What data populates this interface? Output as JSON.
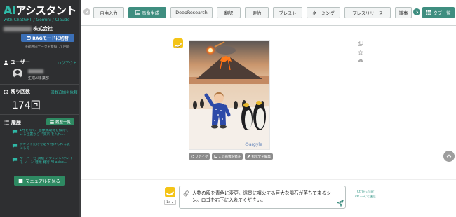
{
  "sidebar": {
    "logo_ai": "AI",
    "logo_rest": "アシスタント",
    "logo_sub": "with ChatGPT / Gemini / Claude",
    "company_suffix": "株式会社",
    "rag_button": "RAGモードに切替",
    "rag_note": "※範囲内データを参照して回答",
    "user_section": "ユーザー",
    "logout": "ログアウト",
    "user_dept": "生成AI事業部",
    "remaining_section": "残り回数",
    "add_request": "回数追加を依頼",
    "remaining_count": "174回",
    "history_section": "履歴",
    "history_button": "履歴一覧",
    "history": [
      {
        "lines": [
          "1月を育て、画像数期待を加えて",
          "いる位置から「東京 を入れ…"
        ]
      },
      {
        "lines": [
          "テキストだけで貼り付けられる表",
          "にして"
        ]
      },
      {
        "lines": [
          "サーバー名 試験 アテンスレ/ホスト",
          "モ ソーン 種類 発行 AI-asiso…"
        ]
      }
    ],
    "manual_button": "マニュアルを見る"
  },
  "tabs": {
    "items": [
      {
        "label": "自由入力",
        "active": false
      },
      {
        "label": "画像生成",
        "active": true
      },
      {
        "label": "DeepResearch",
        "active": false
      },
      {
        "label": "翻訳",
        "active": false
      },
      {
        "label": "要約",
        "active": false
      },
      {
        "label": "ブレスト",
        "active": false
      },
      {
        "label": "ネーミング",
        "active": false
      },
      {
        "label": "プレスリリース",
        "active": false
      },
      {
        "label": "議事",
        "active": false
      }
    ],
    "list_button": "タブ一覧"
  },
  "image": {
    "watermark": "argyle",
    "actions": [
      "リテイク",
      "この画像を修正",
      "指示文を編集"
    ]
  },
  "prompt": {
    "model": "1e",
    "text": "人物の服を青色に変更。遠景に噴火する巨大な隕石が落ちて来るシーン。ロゴを右下に入れてください。",
    "hint_line1": "Ctrl+Enter",
    "hint_line2": "(⌘+↩)で送信"
  },
  "colors": {
    "accent": "#3f8e80",
    "sidebar_bg": "#2e2f31",
    "teal_text": "#2fb8a6",
    "rag_blue": "#3b6fb6"
  }
}
